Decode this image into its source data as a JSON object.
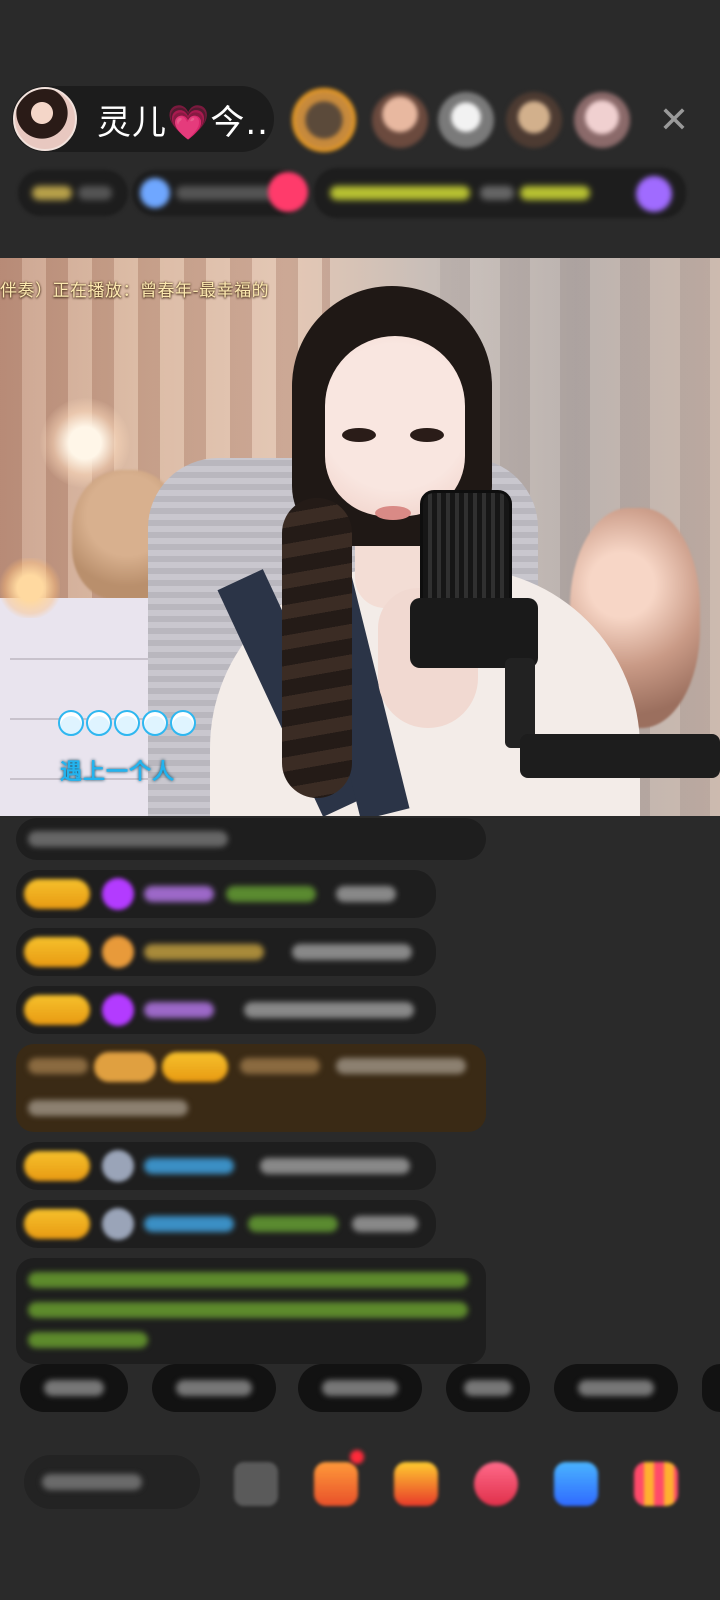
{
  "header": {
    "host_name": "灵儿💗今...",
    "close_glyph": "✕"
  },
  "video": {
    "now_playing": "伴奏）正在播放：曾春年-最幸福的",
    "lyric": "遇上一个人",
    "progress_dots": 5
  },
  "colors": {
    "background": "#2a2a2a",
    "chat_bubble": "#1e1e1e",
    "badge_gold": "#f6c12c",
    "lyric_blue": "#23b3ee",
    "now_playing": "#fce9b0"
  },
  "icons": {
    "close": "close-icon",
    "emoji": "emoji-icon",
    "gift_box": "gift-box-icon",
    "treasure": "treasure-icon",
    "heart": "heart-icon",
    "game": "gamepad-icon",
    "more": "more-grid-icon"
  }
}
